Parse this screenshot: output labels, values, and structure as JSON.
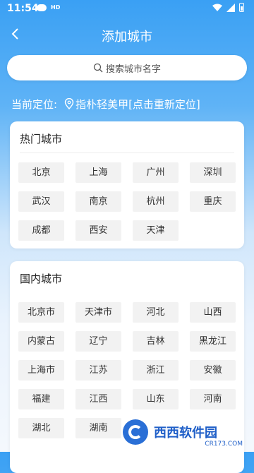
{
  "status_bar": {
    "time": "11:54",
    "hd_label": "HD"
  },
  "header": {
    "title": "添加城市",
    "back_icon": "chevron-left-icon"
  },
  "search": {
    "placeholder": "搜索城市名字",
    "icon": "search-icon"
  },
  "location": {
    "prefix": "当前定位:",
    "value": "指朴轻美甲[点击重新定位]",
    "icon": "map-pin-icon"
  },
  "hot_cities": {
    "title": "热门城市",
    "items": [
      "北京",
      "上海",
      "广州",
      "深圳",
      "武汉",
      "南京",
      "杭州",
      "重庆",
      "成都",
      "西安",
      "天津"
    ]
  },
  "domestic_cities": {
    "title": "国内城市",
    "items": [
      "北京市",
      "天津市",
      "河北",
      "山西",
      "内蒙古",
      "辽宁",
      "吉林",
      "黑龙江",
      "上海市",
      "江苏",
      "浙江",
      "安徽",
      "福建",
      "江西",
      "山东",
      "河南",
      "湖北",
      "湖南"
    ]
  },
  "watermark": {
    "main": "西西软件园",
    "sub": "CR173.COM"
  },
  "colors": {
    "accent": "#3aa0f4",
    "chip_bg": "#f2f2f2"
  }
}
